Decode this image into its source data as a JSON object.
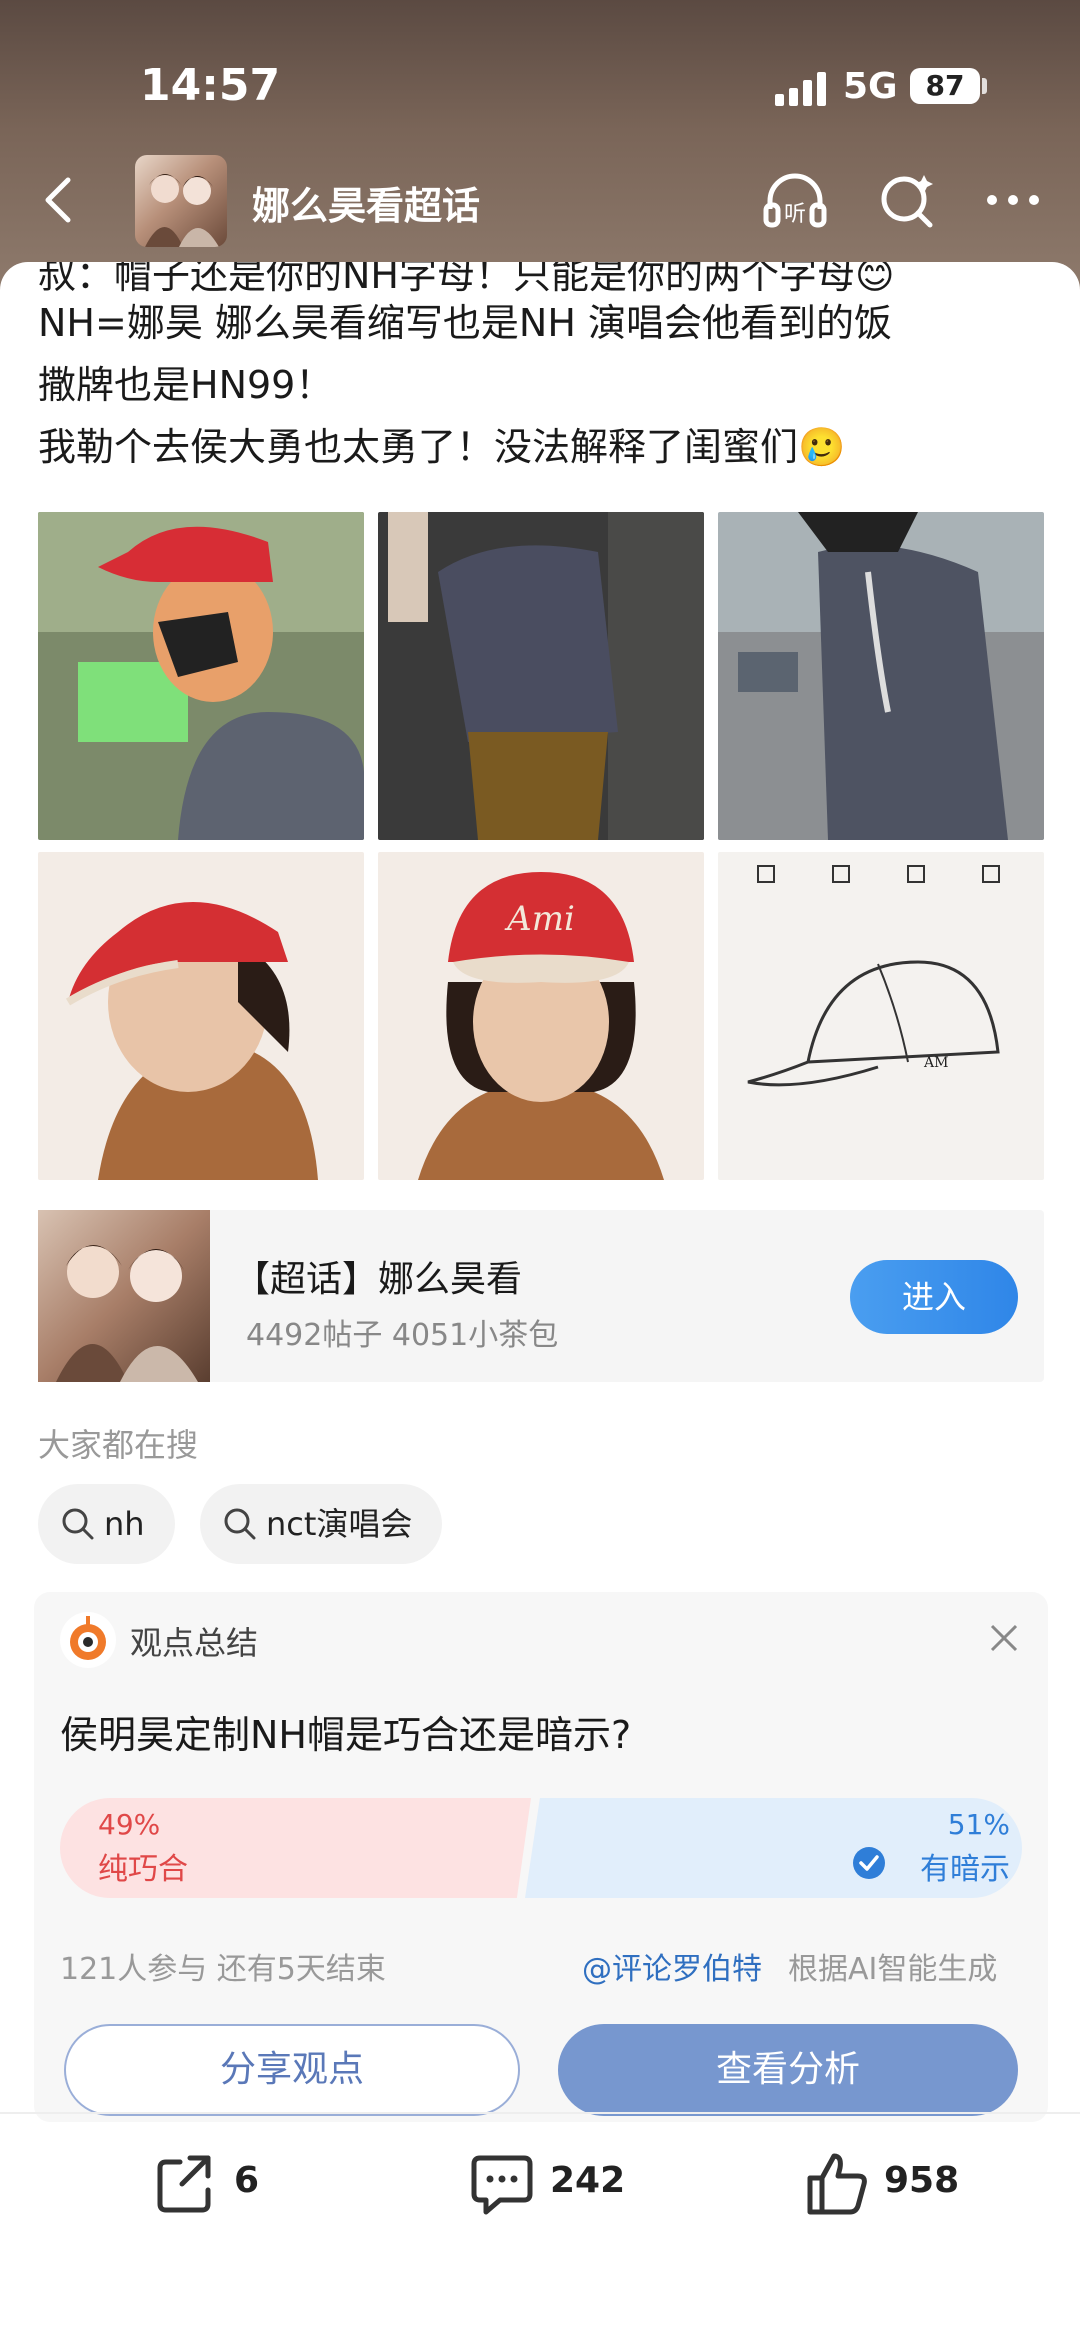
{
  "status_bar": {
    "time": "14:57",
    "network": "5G",
    "battery": "87"
  },
  "nav": {
    "title": "娜么昊看超话",
    "icons": [
      "back-arrow-icon",
      "headphones-listen-icon",
      "search-icon",
      "more-icon"
    ],
    "listen_label": "听"
  },
  "post": {
    "partial_line": "叔：帽子还是你的NH字母！只能是你的两个字母😊",
    "line1": "NH=娜昊  娜么昊看缩写也是NH  演唱会他看到的饭",
    "line2": "撒牌也是HN99！",
    "line3": "我勒个去侯大勇也太勇了！没法解释了闺蜜们🥲"
  },
  "topic": {
    "title": "【超话】娜么昊看",
    "stats": "4492帖子 4051小茶包",
    "enter_label": "进入"
  },
  "search": {
    "label": "大家都在搜",
    "chips": [
      "nh",
      "nct演唱会"
    ]
  },
  "summary": {
    "title": "观点总结",
    "question": "侯明昊定制NH帽是巧合还是暗示?",
    "left": {
      "percent": "49%",
      "label": "纯巧合",
      "value": 0.49
    },
    "right": {
      "percent": "51%",
      "label": "有暗示",
      "value": 0.51
    },
    "participants": "121人参与  还有5天结束",
    "author": "@评论罗伯特",
    "ai_note": "根据AI智能生成",
    "share_label": "分享观点",
    "view_label": "查看分析"
  },
  "actions": {
    "share_count": "6",
    "comment_count": "242",
    "like_count": "958"
  },
  "colors": {
    "accent_blue": "#2f86e8",
    "red": "#e04848",
    "summary_btn": "#7797cf"
  }
}
